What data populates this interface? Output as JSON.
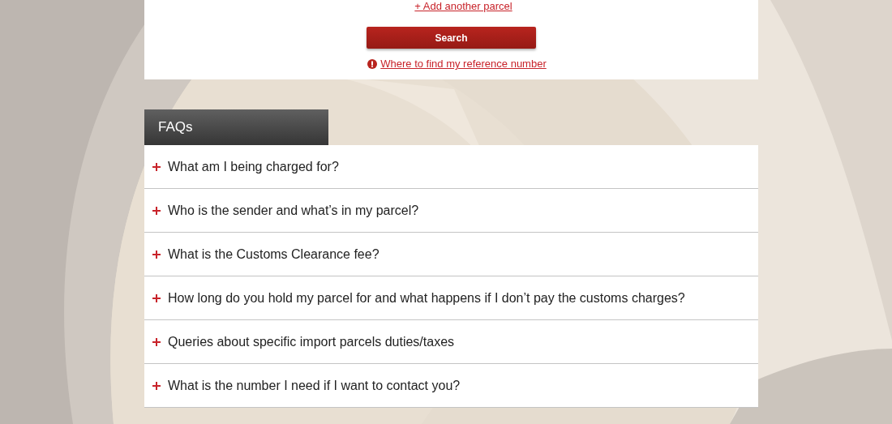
{
  "search_panel": {
    "add_link": "+ Add another parcel",
    "search_button": "Search",
    "help_link": "Where to find my reference number"
  },
  "faqs": {
    "title": "FAQs",
    "items": [
      {
        "question": "What am I being charged for?",
        "expanded": false
      },
      {
        "question": "Who is the sender and what’s in my parcel?",
        "expanded": false
      },
      {
        "question": "What is the Customs Clearance fee?",
        "expanded": false
      },
      {
        "question": "How long do you hold my parcel for and what happens if I don’t pay the customs charges?",
        "expanded": false
      },
      {
        "question": "Queries about specific import parcels duties/taxes",
        "expanded": false
      },
      {
        "question": "What is the number I need if I want to contact you?",
        "expanded": false
      }
    ]
  }
}
